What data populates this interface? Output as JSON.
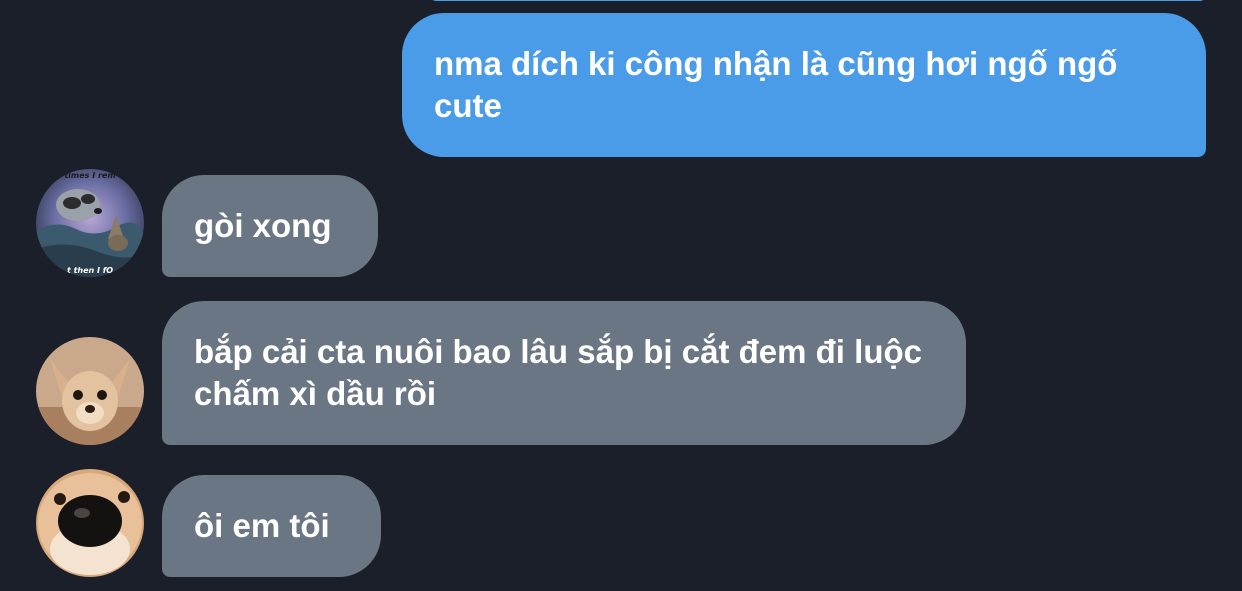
{
  "messages": [
    {
      "direction": "outgoing",
      "text": "nma dích ki công nhận là cũng hơi ngố ngố cute"
    },
    {
      "direction": "incoming",
      "text": "gòi xong",
      "avatar": {
        "icon": "raccoon-wolf-meme-avatar",
        "caption_top": "times I rem",
        "caption_bottom": "t then I fO"
      }
    },
    {
      "direction": "incoming",
      "text": "bắp cải cta nuôi bao lâu sắp bị cắt đem đi luộc chấm xì dầu rồi",
      "avatar": {
        "icon": "chihuahua-avatar"
      }
    },
    {
      "direction": "incoming",
      "text": "ôi em tôi",
      "avatar": {
        "icon": "dog-nose-closeup-avatar"
      }
    }
  ],
  "colors": {
    "background": "#1a1f29",
    "outgoing_bubble": "#4a9ce8",
    "incoming_bubble": "#6b7684",
    "text": "#ffffff"
  }
}
